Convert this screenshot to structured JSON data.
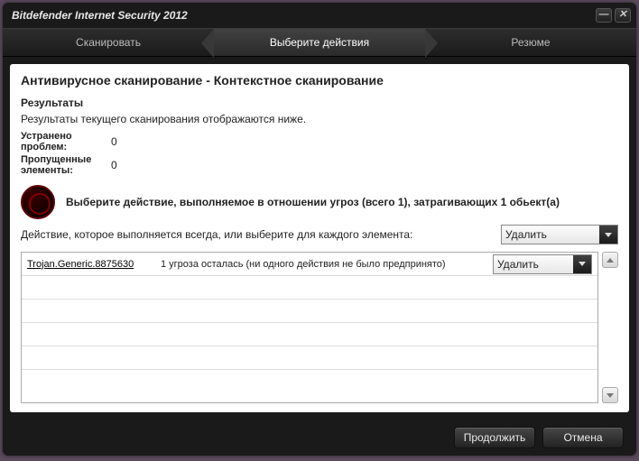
{
  "window": {
    "title": "Bitdefender Internet Security 2012"
  },
  "tabs": {
    "scan": "Сканировать",
    "choose": "Выберите действия",
    "resume": "Резюме"
  },
  "main": {
    "heading": "Антивирусное сканирование - Контекстное сканирование",
    "results_heading": "Результаты",
    "results_desc": "Результаты текущего сканирования отображаются ниже.",
    "fixed_label": "Устранено проблем:",
    "fixed_value": "0",
    "skipped_label": "Пропущенные элементы:",
    "skipped_value": "0",
    "threat_banner": "Выберите действие, выполняемое в отношении угроз (всего 1), затрагивающих 1 обьект(а)",
    "action_label": "Действие, которое выполняется всегда, или выберите для каждого элемента:",
    "global_action": "Удалить"
  },
  "threats": [
    {
      "name": "Trojan.Generic.8875630",
      "status": "1 угроза осталась (ни одного действия не было предпринято)",
      "action": "Удалить"
    }
  ],
  "footer": {
    "continue": "Продолжить",
    "cancel": "Отмена"
  }
}
